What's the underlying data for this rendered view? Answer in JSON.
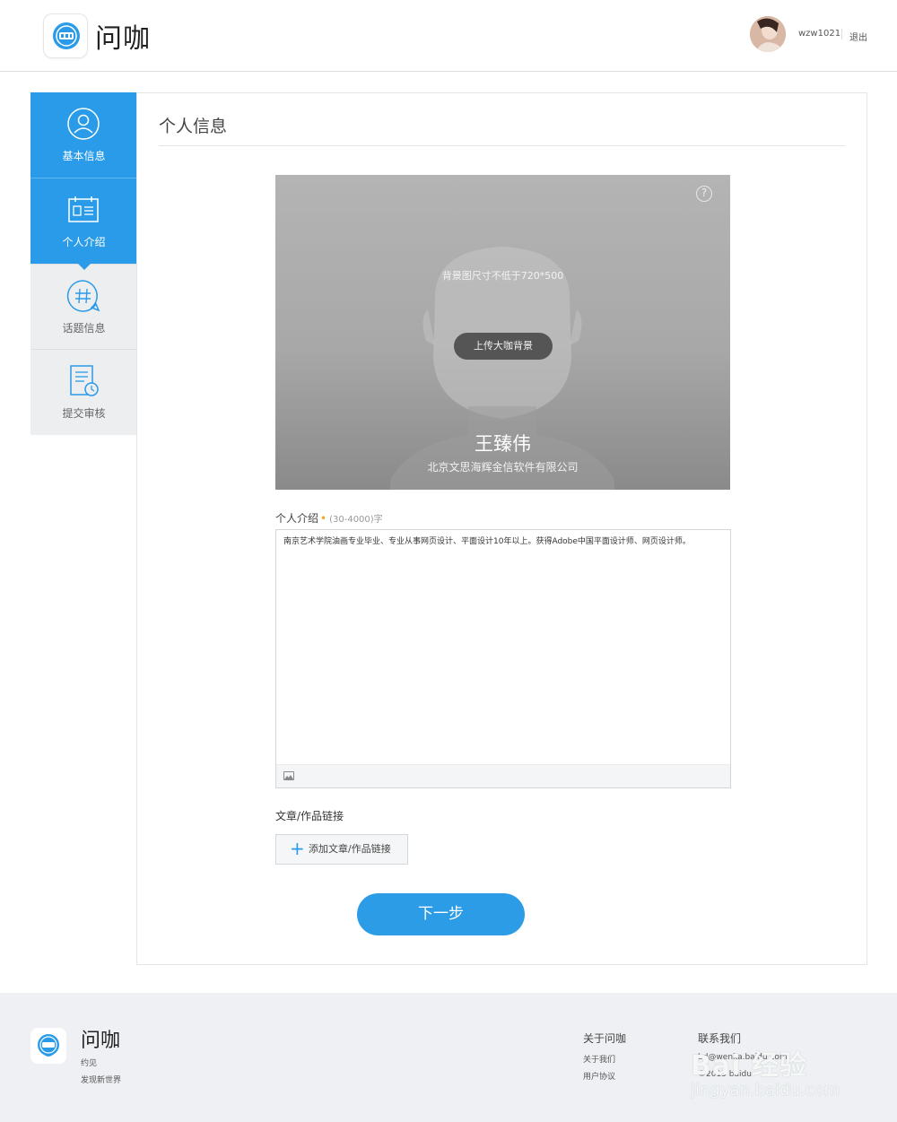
{
  "header": {
    "app_name": "问咖",
    "username": "wzw1021",
    "logout": "退出"
  },
  "sidebar": {
    "items": [
      {
        "label": "基本信息",
        "icon": "user-icon",
        "state": "active"
      },
      {
        "label": "个人介绍",
        "icon": "calendar-card-icon",
        "state": "active"
      },
      {
        "label": "话题信息",
        "icon": "hashtag-chat-icon",
        "state": "inactive"
      },
      {
        "label": "提交审核",
        "icon": "document-clock-icon",
        "state": "inactive"
      }
    ]
  },
  "main": {
    "title": "个人信息",
    "banner": {
      "help_symbol": "?",
      "size_hint": "背景图尺寸不低于720*500",
      "upload_label": "上传大咖背景",
      "name": "王臻伟",
      "company": "北京文思海辉金信软件有限公司"
    },
    "intro": {
      "label": "个人介绍",
      "required_mark": "•",
      "length_hint": "(30-4000)字",
      "text": "南京艺术学院油画专业毕业、专业从事网页设计、平面设计10年以上。获得Adobe中国平面设计师、网页设计师。"
    },
    "links": {
      "label": "文章/作品链接",
      "add_label": "添加文章/作品链接"
    },
    "next_label": "下一步"
  },
  "footer": {
    "app_name": "问咖",
    "slogan1": "约见",
    "slogan2": "发现新世界",
    "about_heading": "关于问咖",
    "about_links": [
      "关于我们",
      "用户协议"
    ],
    "contact_heading": "联系我们",
    "contact_email": "bd@wenka.baidu.com",
    "copyright": "©2015 baidu"
  },
  "watermark": {
    "line1": "Bai 经验",
    "line2": "jingyan.baidu.com"
  },
  "colors": {
    "accent": "#2a9be8",
    "sidebar_inactive": "#eceef0",
    "footer_bg": "#eef0f3"
  }
}
